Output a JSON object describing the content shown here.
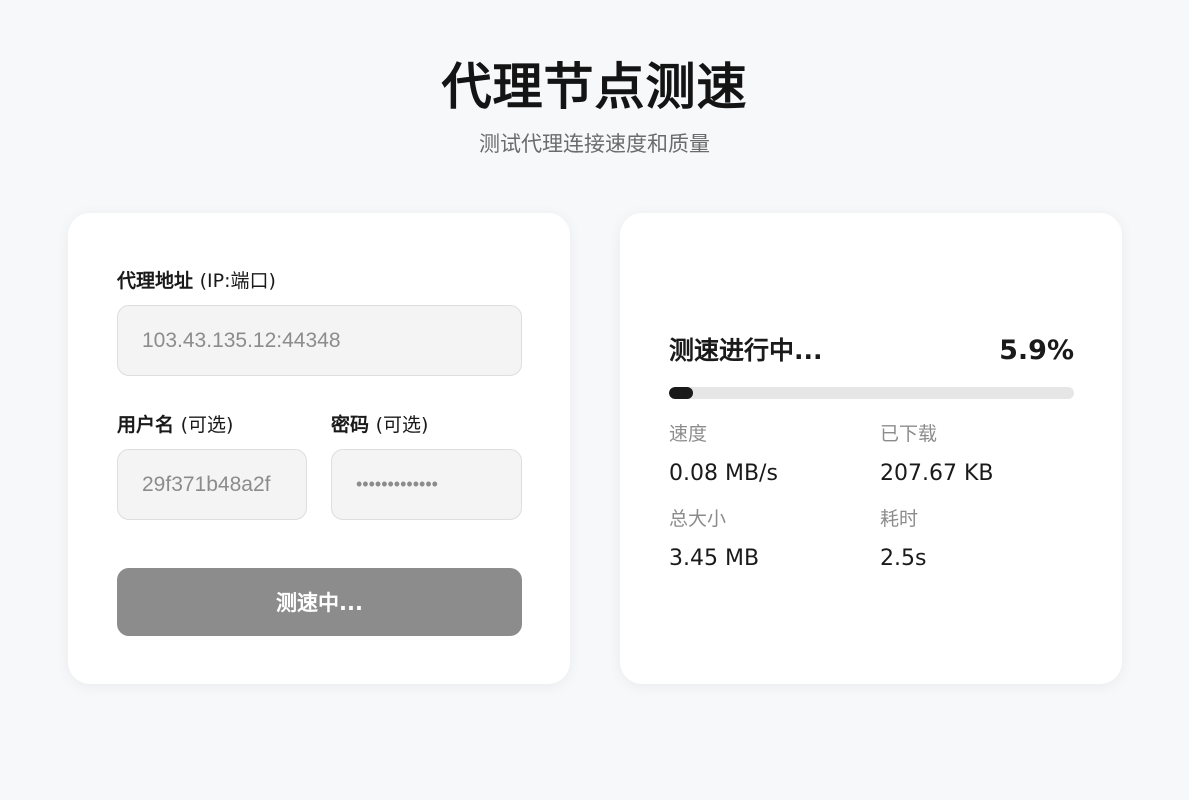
{
  "header": {
    "title": "代理节点测速",
    "subtitle": "测试代理连接速度和质量"
  },
  "form": {
    "address_label": "代理地址",
    "address_hint": "(IP:端口)",
    "address_value": "103.43.135.12:44348",
    "username_label": "用户名",
    "username_hint": "(可选)",
    "username_value": "29f371b48a2f",
    "password_label": "密码",
    "password_hint": "(可选)",
    "password_value": "•••••••••••••",
    "submit_label": "测速中..."
  },
  "result": {
    "status_text": "测速进行中...",
    "progress_text": "5.9%",
    "progress_fraction": 0.059,
    "stats": [
      {
        "label": "速度",
        "value": "0.08 MB/s"
      },
      {
        "label": "已下载",
        "value": "207.67 KB"
      },
      {
        "label": "总大小",
        "value": "3.45 MB"
      },
      {
        "label": "耗时",
        "value": "2.5s"
      }
    ]
  },
  "colors": {
    "background": "#f7f8fa",
    "card": "#ffffff",
    "accent": "#1a1a1a",
    "button_disabled": "#8c8c8c",
    "muted_text": "#8c8c8c"
  }
}
